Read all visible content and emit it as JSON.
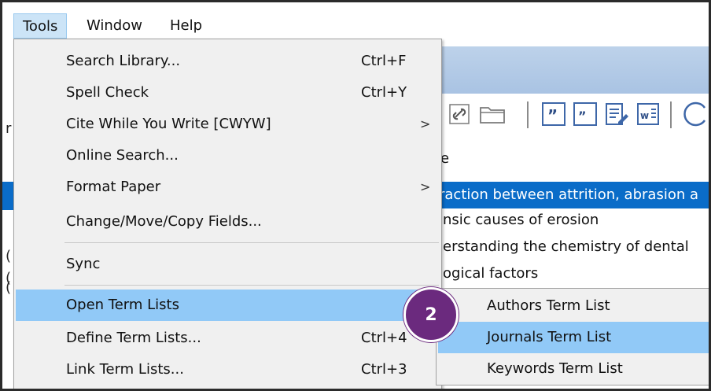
{
  "menubar": {
    "items": [
      "Tools",
      "Window",
      "Help"
    ]
  },
  "tools_menu": {
    "items": [
      {
        "label": "Search Library...",
        "shortcut": "Ctrl+F",
        "arrow": ""
      },
      {
        "label": "Spell Check",
        "shortcut": "Ctrl+Y",
        "arrow": ""
      },
      {
        "label": "Cite While You Write [CWYW]",
        "shortcut": "",
        "arrow": ">"
      },
      {
        "label": "Online Search...",
        "shortcut": "",
        "arrow": ""
      },
      {
        "label": "Format Paper",
        "shortcut": "",
        "arrow": ">"
      },
      {
        "label": "Change/Move/Copy Fields...",
        "shortcut": "",
        "arrow": ""
      },
      {
        "label": "Sync",
        "shortcut": "",
        "arrow": ""
      },
      {
        "label": "Open Term Lists",
        "shortcut": "",
        "arrow": ""
      },
      {
        "label": "Define Term Lists...",
        "shortcut": "Ctrl+4",
        "arrow": ""
      },
      {
        "label": "Link Term Lists...",
        "shortcut": "Ctrl+3",
        "arrow": ""
      }
    ]
  },
  "term_lists_submenu": {
    "items": [
      "Authors Term List",
      "Journals Term List",
      "Keywords Term List"
    ]
  },
  "library": {
    "column_header": "e",
    "rows": [
      "raction between attrition, abrasion a",
      "insic causes of erosion",
      "lerstanding the chemistry of dental",
      "logical factors"
    ]
  },
  "left_glyphs": [
    "r",
    "(",
    "(",
    "(",
    "("
  ],
  "toolbar_icons": [
    "link-icon",
    "folder-icon",
    "quote-icon",
    "insert-citation-icon",
    "edit-citation-icon",
    "word-icon",
    "sync-icon"
  ],
  "badge": {
    "text": "2"
  },
  "colors": {
    "highlight": "#91c9f7",
    "selected_row": "#0a6cc8",
    "badge": "#6b2a7e",
    "menu_bg": "#f0f0f0"
  }
}
